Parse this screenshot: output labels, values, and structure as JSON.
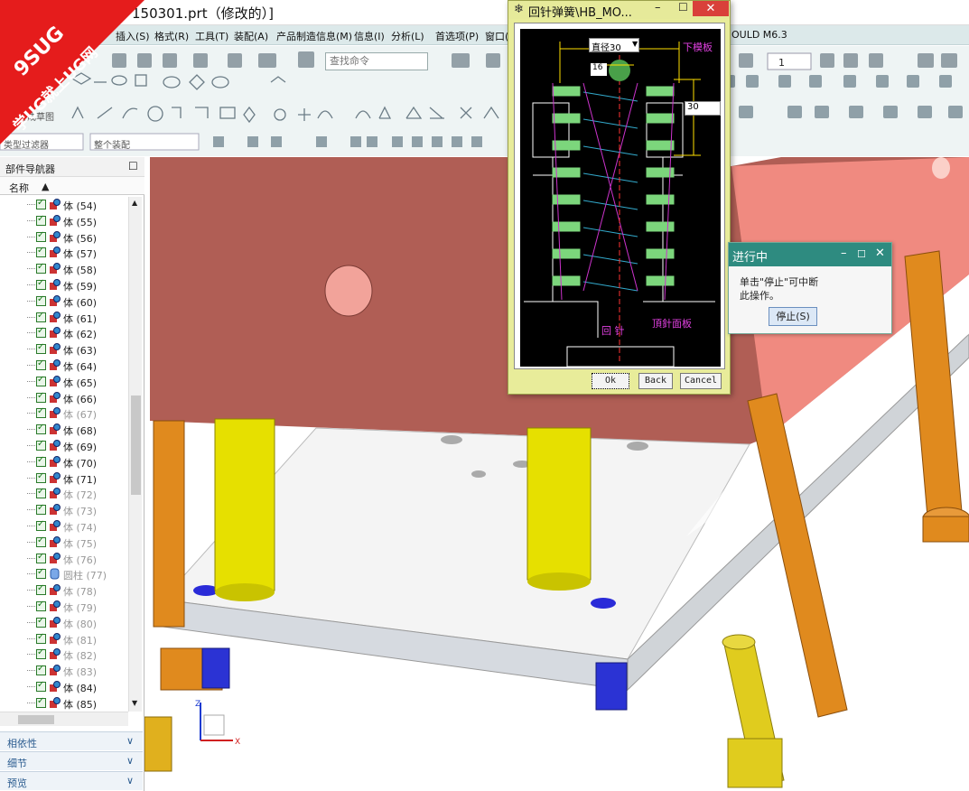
{
  "window": {
    "title": "150301.prt（修改的）]"
  },
  "menubar": {
    "items": [
      "插入(S)",
      "格式(R)",
      "工具(T)",
      "装配(A)",
      "产品制造信息(M)",
      "信息(I)",
      "分析(L)",
      "首选项(P)",
      "窗口("
    ],
    "right_text": "OULD M6.3"
  },
  "toolbar": {
    "search_placeholder": "查找命令",
    "layer_value": "1",
    "filter_label": "类型过滤器",
    "assembly_label": "整个装配",
    "generate_label": "生成草图"
  },
  "navigator": {
    "title": "部件导航器",
    "column": "名称",
    "items": [
      {
        "label": "体 (54)",
        "dim": false
      },
      {
        "label": "体 (55)",
        "dim": false
      },
      {
        "label": "体 (56)",
        "dim": false
      },
      {
        "label": "体 (57)",
        "dim": false
      },
      {
        "label": "体 (58)",
        "dim": false
      },
      {
        "label": "体 (59)",
        "dim": false
      },
      {
        "label": "体 (60)",
        "dim": false
      },
      {
        "label": "体 (61)",
        "dim": false
      },
      {
        "label": "体 (62)",
        "dim": false
      },
      {
        "label": "体 (63)",
        "dim": false
      },
      {
        "label": "体 (64)",
        "dim": false
      },
      {
        "label": "体 (65)",
        "dim": false
      },
      {
        "label": "体 (66)",
        "dim": false
      },
      {
        "label": "体 (67)",
        "dim": true
      },
      {
        "label": "体 (68)",
        "dim": false
      },
      {
        "label": "体 (69)",
        "dim": false
      },
      {
        "label": "体 (70)",
        "dim": false
      },
      {
        "label": "体 (71)",
        "dim": false
      },
      {
        "label": "体 (72)",
        "dim": true
      },
      {
        "label": "体 (73)",
        "dim": true
      },
      {
        "label": "体 (74)",
        "dim": true
      },
      {
        "label": "体 (75)",
        "dim": true
      },
      {
        "label": "体 (76)",
        "dim": true
      },
      {
        "label": "圆柱 (77)",
        "dim": true
      },
      {
        "label": "体 (78)",
        "dim": true
      },
      {
        "label": "体 (79)",
        "dim": true
      },
      {
        "label": "体 (80)",
        "dim": true
      },
      {
        "label": "体 (81)",
        "dim": true
      },
      {
        "label": "体 (82)",
        "dim": true
      },
      {
        "label": "体 (83)",
        "dim": true
      },
      {
        "label": "体 (84)",
        "dim": false
      },
      {
        "label": "体 (85)",
        "dim": false
      }
    ],
    "accordions": [
      "相依性",
      "细节",
      "预览"
    ]
  },
  "dialog": {
    "title": "回针弹簧\\HB_MO...",
    "dia_select": "直径30",
    "dim16": "16",
    "dim30": "30",
    "label_lower_plate": "下模板",
    "label_return_pin": "回  针",
    "label_ejector": "頂針面板",
    "ok": "Ok",
    "back": "Back",
    "cancel": "Cancel"
  },
  "progress": {
    "title": "进行中",
    "msg1": "单击\"停止\"可中断",
    "msg2": "此操作。",
    "stop": "停止(S)"
  },
  "badge": {
    "text1": "9SUG",
    "text2": "学UG就上UG网"
  },
  "colors": {
    "accent": "#2e8b80",
    "menubar": "#dce9ea",
    "dialog": "#e8ec9a",
    "plate": "#b85f55",
    "pin": "#e8e000",
    "post": "#e08a1e"
  }
}
